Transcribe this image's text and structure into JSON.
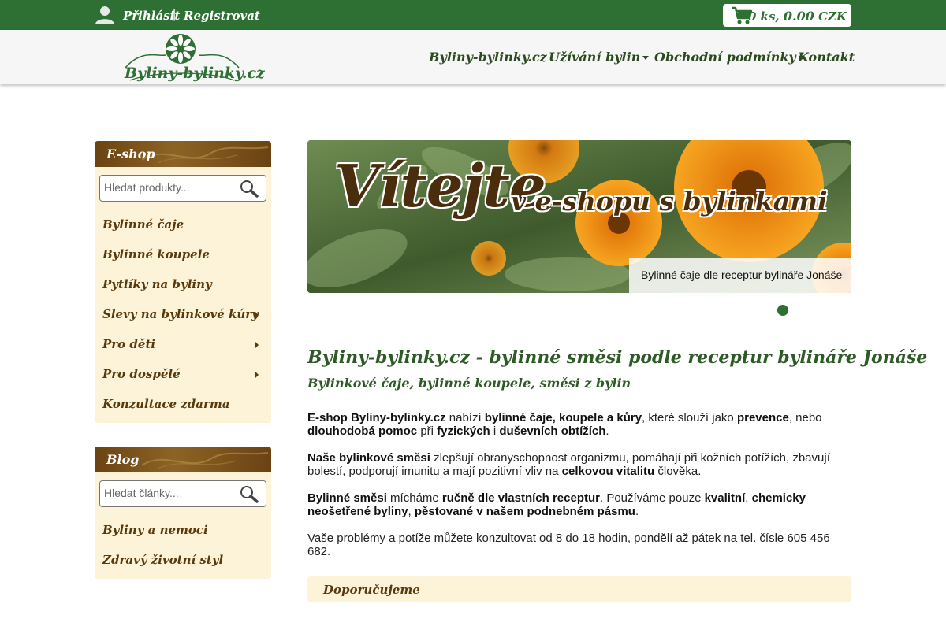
{
  "topbar": {
    "login": "Přihlásit",
    "separator": "|",
    "register": "Registrovat",
    "cart_count": "0 ks,",
    "cart_total": "0.00",
    "cart_currency": "CZK"
  },
  "header": {
    "logo_text": "Byliny-bylinky.cz",
    "nav": [
      {
        "label": "Byliny-bylinky.cz",
        "dropdown": false
      },
      {
        "label": "Užívání bylin",
        "dropdown": true
      },
      {
        "label": "Obchodní podmínky",
        "dropdown": true
      },
      {
        "label": "Kontakt",
        "dropdown": false
      }
    ]
  },
  "eshop": {
    "title": "E-shop",
    "search_placeholder": "Hledat produkty...",
    "items": [
      {
        "label": "Bylinné čaje",
        "submenu": false
      },
      {
        "label": "Bylinné koupele",
        "submenu": false
      },
      {
        "label": "Pytlíky na byliny",
        "submenu": false
      },
      {
        "label": "Slevy na bylinkové kúry",
        "submenu": true
      },
      {
        "label": "Pro děti",
        "submenu": true
      },
      {
        "label": "Pro dospělé",
        "submenu": true
      },
      {
        "label": "Konzultace zdarma",
        "submenu": false
      }
    ]
  },
  "blog": {
    "title": "Blog",
    "search_placeholder": "Hledat články...",
    "items": [
      {
        "label": "Byliny a nemoci"
      },
      {
        "label": "Zdravý životní styl"
      }
    ]
  },
  "banner": {
    "title": "Vítejte",
    "subtitle": "v e-shopu s bylinkami",
    "caption": "Bylinné čaje dle receptur bylináře Jonáše"
  },
  "main": {
    "heading": "Byliny-bylinky.cz - bylinné směsi podle receptur bylináře Jonáše",
    "subheading": "Bylinkové čaje, bylinné koupele, směsi z bylin",
    "p1": [
      "E-shop Byliny-bylinky.cz",
      " nabízí ",
      "bylinné čaje, koupele a kůry",
      ", které slouží jako ",
      "prevence",
      ", nebo ",
      "dlouhodobá pomoc",
      " při ",
      "fyzických",
      " i ",
      "duševních obtížích",
      "."
    ],
    "p2": [
      "Naše bylinkové směsi",
      " zlepšují obranyschopnost organizmu, pomáhají při kožních potížích, zbavují bolestí, podporují imunitu a mají pozitivní vliv na ",
      "celkovou vitalitu",
      " člověka."
    ],
    "p3": [
      "Bylinné směsi",
      " mícháme ",
      "ručně dle vlastních receptur",
      ". Používáme pouze ",
      "kvalitní",
      ", ",
      "chemicky neošetřené byliny",
      ", ",
      "pěstované v našem podnebném pásmu",
      "."
    ],
    "p4": "Vaše problémy a potíže můžete konzultovat od 8 do 18 hodin, pondělí až pátek na tel. čísle 605 456 682.",
    "recommend": "Doporučujeme"
  },
  "colors": {
    "green": "#2e6f34",
    "brown": "#6a4313",
    "cream": "#fdf3d8"
  }
}
